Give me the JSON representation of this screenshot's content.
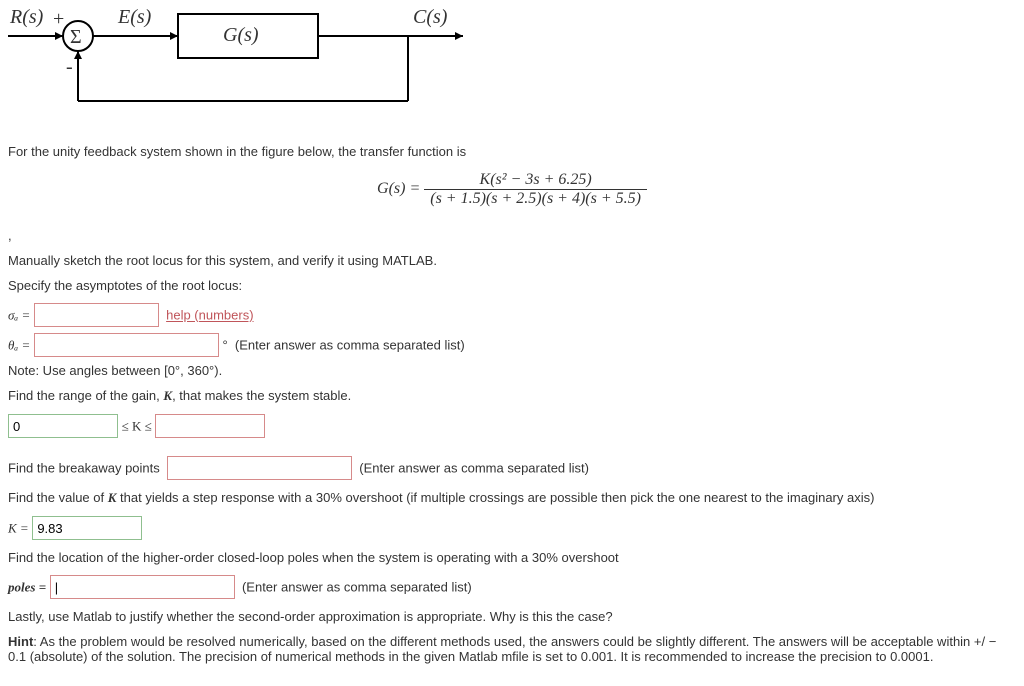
{
  "diagram": {
    "r_label": "R(s)",
    "sum_plus": "+",
    "sum_minus": "-",
    "sum_symbol": "Σ",
    "e_label": "E(s)",
    "g_label": "G(s)",
    "c_label": "C(s)"
  },
  "intro": "For the unity feedback system shown in the figure below, the transfer function is",
  "tf": {
    "lhs": "G(s) =",
    "num": "K(s² − 3s + 6.25)",
    "den": "(s + 1.5)(s + 2.5)(s + 4)(s + 5.5)"
  },
  "sketch_line": "Manually sketch the root locus for this system, and verify it using MATLAB.",
  "asymptotes": {
    "header": "Specify the asymptotes of the root locus:",
    "sigma_label": "σₐ =",
    "sigma_help": "help (numbers)",
    "theta_label": "θₐ =",
    "theta_units": "°",
    "theta_note_inline": "(Enter answer as comma separated list)",
    "note": "Note: Use angles between [0°, 360°)."
  },
  "gain_range": {
    "header_prefix": "Find the range of the gain, ",
    "header_K": "K",
    "header_suffix": ", that makes the system stable.",
    "lower_value": "0",
    "rel": "≤ K ≤"
  },
  "breakaway": {
    "label": "Find the breakaway points",
    "note": "(Enter answer as comma separated list)"
  },
  "overshoot_k": {
    "text_prefix": "Find the value of ",
    "text_K": "K",
    "text_mid": " that yields a step response with a ",
    "percent": "30%",
    "text_suffix": " overshoot (if multiple crossings are possible then pick the one nearest to the imaginary axis)",
    "k_label": "K =",
    "k_value": "9.83"
  },
  "poles": {
    "text": "Find the location of the higher-order closed-loop poles when the system is operating with a ",
    "percent": "30%",
    "text_suffix": " overshoot",
    "label": "poles =",
    "value": "|",
    "note": "(Enter answer as comma separated list)"
  },
  "justify": "Lastly, use Matlab to justify whether the second-order approximation is appropriate. Why is this the case?",
  "hint": {
    "label": "Hint",
    "body": ": As the problem would be resolved numerically, based on the different methods used, the answers could be slightly different. The answers will be acceptable within ",
    "tol": "+/ − 0.1",
    "body2": " (absolute) of the solution. The precision of numerical methods in the given Matlab mfile is set to 0.001. It is recommended to increase the precision to 0.0001."
  }
}
